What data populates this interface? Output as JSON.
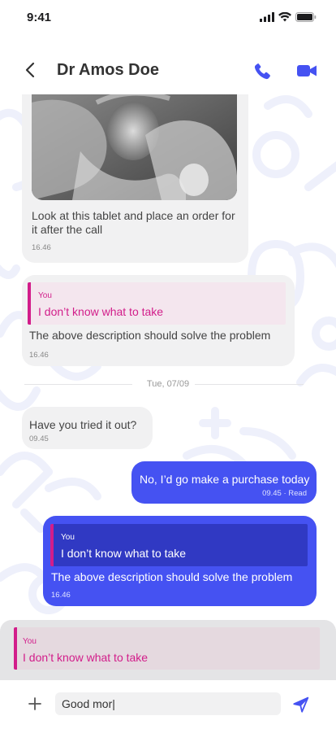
{
  "status_bar": {
    "time": "9:41",
    "icons": [
      "signal-icon",
      "wifi-icon",
      "battery-icon"
    ]
  },
  "header": {
    "back_icon": "chevron-left-icon",
    "title": "Dr Amos Doe",
    "call_icon": "phone-icon",
    "video_icon": "video-camera-icon"
  },
  "colors": {
    "accent": "#4552f2",
    "quote_accent": "#d21d8a",
    "incoming_bubble": "#f1f1f2"
  },
  "messages": [
    {
      "direction": "incoming",
      "has_image": true,
      "image_desc": "x-ray image",
      "text": "Look at this tablet and place an order for it after the call",
      "time": "16.46"
    },
    {
      "direction": "incoming",
      "quote": {
        "author": "You",
        "text": "I don’t know what to take"
      },
      "text": "The above description should solve the problem",
      "time": "16.46"
    },
    {
      "direction": "divider",
      "label": "Tue, 07/09"
    },
    {
      "direction": "incoming",
      "text": "Have you tried it out?",
      "time": "09.45"
    },
    {
      "direction": "outgoing",
      "text": "No, I’d go make a purchase today",
      "time": "09.45 · Read"
    },
    {
      "direction": "outgoing",
      "quote": {
        "author": "You",
        "text": "I don’t know what to take"
      },
      "text": "The above description should solve the problem",
      "time": "16.46"
    }
  ],
  "reply_preview": {
    "author": "You",
    "text": "I don’t know what to take"
  },
  "composer": {
    "plus_icon": "plus-icon",
    "value": "Good mor|",
    "send_icon": "send-icon"
  }
}
